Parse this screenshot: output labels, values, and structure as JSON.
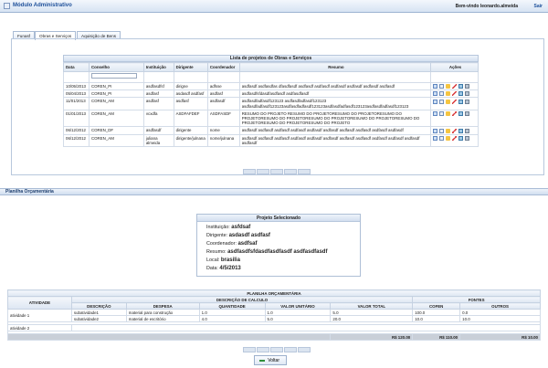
{
  "header": {
    "title": "Módulo Administrativo",
    "welcome": "Bem-vindo leonardo.almeida",
    "logout": "Sair"
  },
  "tabs": [
    {
      "label": "Funasf"
    },
    {
      "label": "Obras e Serviços"
    },
    {
      "label": "Aquisição de Bens"
    }
  ],
  "projects": {
    "title": "Lista de projetos de Obras e Serviços",
    "columns": [
      "Data",
      "Conselho",
      "Instituição",
      "Dirigente",
      "Coordenador",
      "Resumo",
      "Ações"
    ],
    "rows": [
      {
        "data": "10/05/2013",
        "conselho": "COREN_PI",
        "instituicao": "asdfasdfsf",
        "dirigente": "dirigne",
        "coordenador": "adfsse",
        "resumo": "asdfasdf asdfasdfas dfasdfasdf asdfasdf asdfasdf asdfasdf asdfasdf asdfasdf asdfasdf"
      },
      {
        "data": "05/04/2013",
        "conselho": "COREN_PI",
        "instituicao": "asdfasf",
        "dirigente": "asdasdf asdfasf",
        "coordenador": "asdfasf",
        "resumo": "asdfasdfsfdasdfasdfasdf asdfasdfasdf"
      },
      {
        "data": "11/01/2013",
        "conselho": "COREN_AM",
        "instituicao": "asdfasf",
        "dirigente": "asdfasf",
        "coordenador": "asdfasdf",
        "resumo": "asdfasdfadfasdf123123 asdfasdfadfasdf123123 asdfasdfadfasdf123123asdfasdfadfasdf123123asdfasdfadfasdf123123asdfasdfadfasdf123123"
      },
      {
        "data": "01/01/2013",
        "conselho": "COREN_AM",
        "instituicao": "vcxdfa",
        "dirigente": "ASDFAFDEF",
        "coordenador": "ASDFASDF",
        "resumo": "RESUMO DO PROJETO RESUMO DO PROJETORESUMO DO PROJETORESUMO DO PROJETORESUMO DO PROJETORESUMO DO PROJETORESUMO DO PROJETORESUMO DO PROJETORESUMO DO PROJETORESUMO DO PROJETO"
      },
      {
        "data": "06/12/2012",
        "conselho": "COREN_DF",
        "instituicao": "asdfasdf",
        "dirigente": "dirigente",
        "coordenador": "nome",
        "resumo": "asdfasdf asdfasdf asdfasdf asdfasdf asdfasdf asdfasdf asdfasdf asdfasdf asdfasdf asdfasdf"
      },
      {
        "data": "06/12/2012",
        "conselho": "COREN_AM",
        "instituicao": "juliana almeida",
        "dirigente": "dirigente/julnana",
        "coordenador": "nome/julnana",
        "resumo": "asdfasdf asdfasdf asdfasdf asdfasdf asdfasdf asdfasdf asdfasdf asdfasdf asdfasdf asdfasdf asdfasdf asdfasdf"
      }
    ],
    "action_icons": [
      "view-icon",
      "list-icon",
      "warning-icon",
      "chart-icon",
      "edit-icon",
      "delete-icon"
    ]
  },
  "section_planilha": "Planilha Orçamentária",
  "selected": {
    "title": "Projeto Selecionado",
    "fields": [
      {
        "label": "Instituição:",
        "value": "asfdsaf"
      },
      {
        "label": "Dirigente:",
        "value": "asdasdf asdfasf"
      },
      {
        "label": "Coordenador:",
        "value": "asdfsaf"
      },
      {
        "label": "Resumo:",
        "value": "asdfasdfsfdasdfasdfasdf asdfasdfasdf"
      },
      {
        "label": "Local:",
        "value": "brasilia"
      },
      {
        "label": "Data:",
        "value": "4/5/2013"
      }
    ]
  },
  "budget": {
    "title": "PLANILHA ORÇAMENTÁRIA",
    "h_atividade": "ATIVIDADE",
    "h_calculo": "DESCRIÇÃO DE CALCULO",
    "h_fontes": "FONTES",
    "cols": [
      "DESCRIÇÃO",
      "DESPESA",
      "QUANTIDADE",
      "VALOR UNITÁRIO",
      "VALOR TOTAL",
      "COFEN",
      "OUTROS"
    ],
    "groups": [
      {
        "atividade": "atividade 1",
        "rows": [
          {
            "descricao": "subatividade1",
            "despesa": "material para construção",
            "quantidade": "1.0",
            "unitario": "1.0",
            "total": "5.0",
            "cofen": "100.0",
            "outros": "0.0"
          },
          {
            "descricao": "subatividade2",
            "despesa": "material de escritório",
            "quantidade": "4.0",
            "unitario": "5.0",
            "total": "20.0",
            "cofen": "10.0",
            "outros": "10.0"
          }
        ]
      },
      {
        "atividade": "atividade 2",
        "rows": []
      }
    ],
    "totals": {
      "total": "R$ 120.00",
      "cofen": "R$ 110.00",
      "outros": "R$ 10.00"
    }
  },
  "buttons": {
    "voltar": "Voltar"
  }
}
